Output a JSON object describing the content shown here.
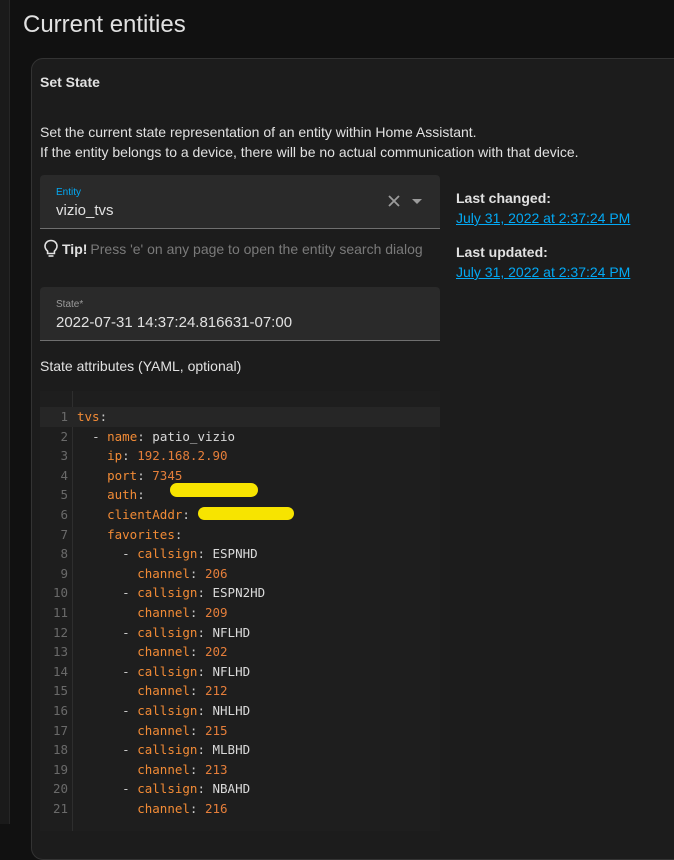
{
  "page": {
    "title": "Current entities"
  },
  "card": {
    "header": "Set State",
    "description": [
      "Set the current state representation of an entity within Home Assistant.",
      "If the entity belongs to a device, there will be no actual communication with that device."
    ]
  },
  "entity_field": {
    "label": "Entity",
    "value": "vizio_tvs"
  },
  "tip": {
    "strong": "Tip!",
    "text": "Press 'e' on any page to open the entity search dialog"
  },
  "state_field": {
    "label": "State*",
    "value": "2022-07-31 14:37:24.816631-07:00"
  },
  "meta": {
    "last_changed_label": "Last changed:",
    "last_changed_value": "July 31, 2022 at 2:37:24 PM",
    "last_updated_label": "Last updated:",
    "last_updated_value": "July 31, 2022 at 2:37:24 PM"
  },
  "yaml": {
    "label": "State attributes (YAML, optional)",
    "lines": [
      {
        "n": "1",
        "indent": "",
        "dash": "",
        "key": "tvs",
        "val": "",
        "vtype": ""
      },
      {
        "n": "2",
        "indent": "  ",
        "dash": "- ",
        "key": "name",
        "val": "patio_vizio",
        "vtype": "s"
      },
      {
        "n": "3",
        "indent": "    ",
        "dash": "",
        "key": "ip",
        "val": "192.168.2.90",
        "vtype": "n"
      },
      {
        "n": "4",
        "indent": "    ",
        "dash": "",
        "key": "port",
        "val": "7345",
        "vtype": "n"
      },
      {
        "n": "5",
        "indent": "    ",
        "dash": "",
        "key": "auth",
        "val": "",
        "vtype": ""
      },
      {
        "n": "6",
        "indent": "    ",
        "dash": "",
        "key": "clientAddr",
        "val": "",
        "vtype": ""
      },
      {
        "n": "7",
        "indent": "    ",
        "dash": "",
        "key": "favorites",
        "val": "",
        "vtype": ""
      },
      {
        "n": "8",
        "indent": "      ",
        "dash": "- ",
        "key": "callsign",
        "val": "ESPNHD",
        "vtype": "s"
      },
      {
        "n": "9",
        "indent": "        ",
        "dash": "",
        "key": "channel",
        "val": "206",
        "vtype": "n"
      },
      {
        "n": "10",
        "indent": "      ",
        "dash": "- ",
        "key": "callsign",
        "val": "ESPN2HD",
        "vtype": "s"
      },
      {
        "n": "11",
        "indent": "        ",
        "dash": "",
        "key": "channel",
        "val": "209",
        "vtype": "n"
      },
      {
        "n": "12",
        "indent": "      ",
        "dash": "- ",
        "key": "callsign",
        "val": "NFLHD",
        "vtype": "s"
      },
      {
        "n": "13",
        "indent": "        ",
        "dash": "",
        "key": "channel",
        "val": "202",
        "vtype": "n"
      },
      {
        "n": "14",
        "indent": "      ",
        "dash": "- ",
        "key": "callsign",
        "val": "NFLHD",
        "vtype": "s"
      },
      {
        "n": "15",
        "indent": "        ",
        "dash": "",
        "key": "channel",
        "val": "212",
        "vtype": "n"
      },
      {
        "n": "16",
        "indent": "      ",
        "dash": "- ",
        "key": "callsign",
        "val": "NHLHD",
        "vtype": "s"
      },
      {
        "n": "17",
        "indent": "        ",
        "dash": "",
        "key": "channel",
        "val": "215",
        "vtype": "n"
      },
      {
        "n": "18",
        "indent": "      ",
        "dash": "- ",
        "key": "callsign",
        "val": "MLBHD",
        "vtype": "s"
      },
      {
        "n": "19",
        "indent": "        ",
        "dash": "",
        "key": "channel",
        "val": "213",
        "vtype": "n"
      },
      {
        "n": "20",
        "indent": "      ",
        "dash": "- ",
        "key": "callsign",
        "val": "NBAHD",
        "vtype": "s"
      },
      {
        "n": "21",
        "indent": "        ",
        "dash": "",
        "key": "channel",
        "val": "216",
        "vtype": "n"
      }
    ]
  },
  "colors": {
    "accent": "#03a9f4",
    "yaml_key": "#f28b36",
    "redaction": "#f7e400"
  },
  "icons": {
    "clear": "close-icon",
    "dropdown": "chevron-down-icon",
    "tip": "lightbulb-icon"
  }
}
